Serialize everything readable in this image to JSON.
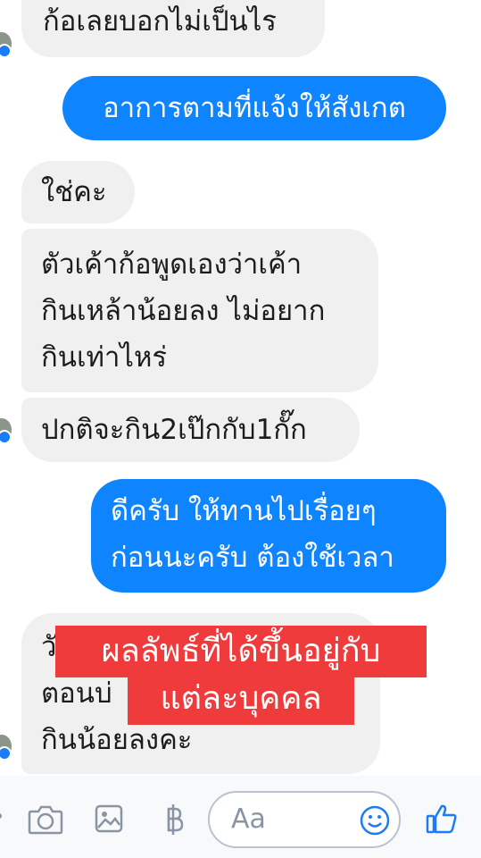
{
  "messages": [
    {
      "side": "in",
      "text": "ก้อเลยบอกไม่เป็นไร"
    },
    {
      "side": "out",
      "text": "อาการตามที่แจ้งให้สังเกต"
    },
    {
      "side": "in",
      "text": "ใช่คะ"
    },
    {
      "side": "in",
      "text": "ตัวเค้าก้อพูดเองว่าเค้า\nกินเหล้าน้อยลง ไม่อยาก\nกินเท่าไหร่"
    },
    {
      "side": "in",
      "text": "ปกติจะกิน2เป๊กกับ1กั๊ก"
    },
    {
      "side": "out",
      "text": "ดีครับ ให้ทานไปเรื่อยๆ\nก่อนนะครับ ต้องใช้เวลา"
    },
    {
      "side": "in",
      "text": "วั\nตอนบ่\nกินน้อยลงคะ"
    }
  ],
  "overlay": {
    "line1": "ผลลัพธ์ที่ได้ขึ้นอยู่กับ",
    "line2": "แต่ละบุคคล"
  },
  "composer": {
    "placeholder": "Aa",
    "icons": [
      "camera-icon",
      "image-icon",
      "baht-icon",
      "smiley-icon",
      "thumbs-up-icon"
    ]
  },
  "colors": {
    "outgoing_bubble": "#0f84ff",
    "incoming_bubble": "#f0f0f1",
    "overlay": "#ef3b3b",
    "composer_icon": "#8a95a3",
    "accent": "#1a7cf6"
  }
}
